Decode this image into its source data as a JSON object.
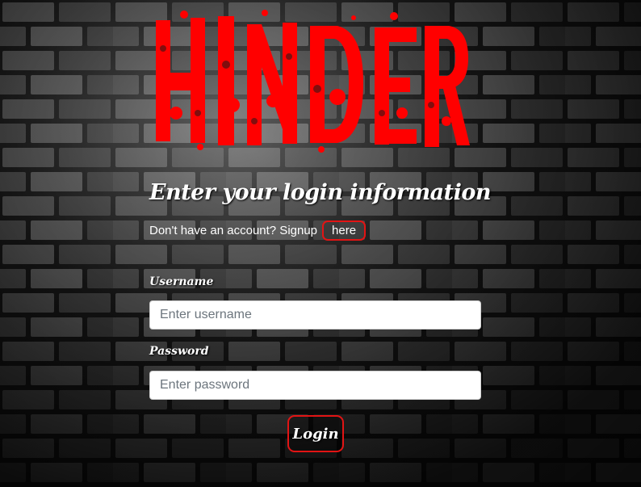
{
  "logo": {
    "alt": "HINDER",
    "color": "#ff0000"
  },
  "login": {
    "heading": "Enter your login information",
    "signup_prompt": "Don't have an account? Signup",
    "signup_link": "here"
  },
  "form": {
    "username_label": "Username",
    "username_placeholder": "Enter username",
    "username_value": "",
    "password_label": "Password",
    "password_placeholder": "Enter password",
    "password_value": "",
    "submit_label": "Login"
  },
  "colors": {
    "accent": "#e21414",
    "background": "#262626",
    "text": "#ffffff"
  }
}
